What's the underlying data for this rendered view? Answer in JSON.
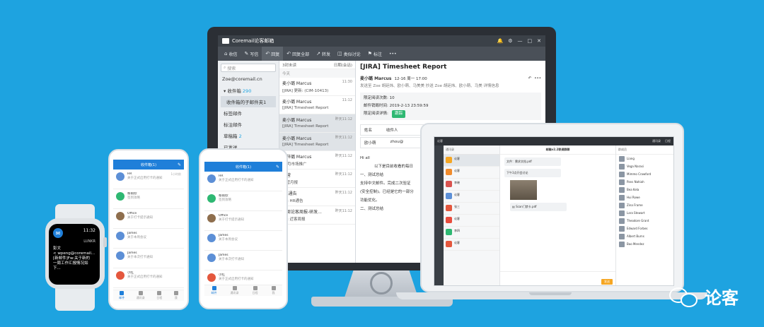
{
  "desktop": {
    "app_title": "Coremail论客邮箱",
    "toolbar": [
      {
        "icon": "inbox-icon",
        "label": "收信"
      },
      {
        "icon": "compose-icon",
        "label": "写信"
      },
      {
        "icon": "reply-icon",
        "label": "回复"
      },
      {
        "icon": "reply-all-icon",
        "label": "回复全部"
      },
      {
        "icon": "forward-icon",
        "label": "转发"
      },
      {
        "icon": "discuss-icon",
        "label": "类似讨论"
      },
      {
        "icon": "tag-icon",
        "label": "标注"
      },
      {
        "icon": "more-icon",
        "label": "•••"
      }
    ],
    "search_placeholder": "搜索",
    "account": "Zoe@coremail.cn",
    "folders": [
      {
        "label": "收件箱",
        "count": "290"
      },
      {
        "label": "收件箱的子邮件夹1",
        "count": ""
      },
      {
        "label": "标签邮件",
        "count": ""
      },
      {
        "label": "标注邮件",
        "count": ""
      },
      {
        "label": "草稿箱",
        "count": "2"
      },
      {
        "label": "已发送",
        "count": ""
      }
    ],
    "list_head_left": "3封未读",
    "list_head_right": "日期(会话)",
    "list_section": "今天",
    "mails": [
      {
        "from": "麦小璐 Marcus",
        "time": "11:30",
        "subject": "[JIRA] 更新: (CIM-10413)"
      },
      {
        "from": "麦小璐 Marcus",
        "time": "11:12",
        "subject": "[JIRA] Timesheet Report"
      },
      {
        "from": "麦小璐 Marcus",
        "time": "昨天11:12",
        "subject": "[JIRA] Timesheet Report"
      },
      {
        "from": "麦小璐 Marcus",
        "time": "昨天11:12",
        "subject": "[JIRA] Timesheet Report"
      },
      {
        "from": "麦梓璐 Marcus",
        "time": "昨天11:12",
        "subject": "10月市场推广"
      },
      {
        "from": "运营",
        "time": "昨天11:12",
        "subject": "运营月报"
      },
      {
        "from": "HR通告",
        "time": "昨天11:12",
        "subject": "Re: HR通告"
      },
      {
        "from": "本周论客周报-研发...",
        "time": "昨天11:12",
        "subject": "Re: 近客周报"
      }
    ],
    "reader": {
      "title": "[JIRA] Timesheet Report",
      "from": "麦小璐 Marcus",
      "date": "12-16 周一 17:00",
      "detail_link": "详情信息",
      "meta": "发送至  Zoe 胡廷炜、欧小萌、马美美     抄送  Zoe 胡廷炜、欧小萌、马美",
      "row1": "限定阅读次数:   10",
      "row2": "邮件销毁时间:   2019-2-13 23:59:59",
      "row3_label": "限定阅读详情:",
      "row3_tag": "跟踪",
      "table_h1": "姓名",
      "table_h2": "收件人",
      "table_c1": "欧小萌",
      "table_c2": "zhou@",
      "greeting": "Hi all",
      "body1": "以下是目前收看的每日",
      "body2": "一、测试总结",
      "body3": "支持中文邮件。完成二次验证",
      "body4": "(安全控制)。已经是它的一部分",
      "body5": "功能优化。",
      "body6": "二、测试总结"
    }
  },
  "laptop": {
    "top_items": [
      "论客",
      "通讯录",
      "日程"
    ],
    "list_head": "通讯录",
    "chat_title": "邮箱v2.2联调群聊",
    "list": [
      {
        "name": "论客",
        "color": "#f5a623"
      },
      {
        "name": "论客",
        "color": "#f08b2c"
      },
      {
        "name": "李晓",
        "color": "#d9534f"
      },
      {
        "name": "论客",
        "color": "#5c8fd6"
      },
      {
        "name": "张三",
        "color": "#e4573d"
      },
      {
        "name": "论客",
        "color": "#e84c3d"
      },
      {
        "name": "李四",
        "color": "#2eb872"
      },
      {
        "name": "论客",
        "color": "#e4573d"
      }
    ],
    "bubble1": "文件：需求文档.pdf",
    "bubble2": "下午3点开会讨论",
    "file": "Scan门禁卡.pdf",
    "send_label": "发送",
    "members_head": "群成员",
    "members": [
      "Liang",
      "Vega Narasi",
      "Mimmo Crawford",
      "Pans Nahiah",
      "Bea Kela",
      "Hui Rowe",
      "Zina Frame",
      "Lara Stewart",
      "Theodore Grant",
      "Edward Forbes",
      "Albert Burns",
      "Bao Mendez"
    ]
  },
  "phone1": {
    "title": "收件箱(1)",
    "items": [
      {
        "name": "HR",
        "text": "关于正式启用打卡的通知",
        "time": "1小时前",
        "color": "#5c8fd6"
      },
      {
        "name": "蔡雨欣",
        "text": "签到攻略",
        "time": "",
        "color": "#2eb872"
      },
      {
        "name": "Office",
        "text": "关于打卡提示通知",
        "time": "",
        "color": "#8e6e4d"
      },
      {
        "name": "James",
        "text": "关于本周会议",
        "time": "",
        "color": "#5c8fd6"
      },
      {
        "name": "James",
        "text": "关于本次打卡通知",
        "time": "",
        "color": "#5c8fd6"
      },
      {
        "name": "小红",
        "text": "关于正式启用打卡的通知",
        "time": "",
        "color": "#e4573d"
      },
      {
        "name": "小红",
        "text": "关于正式启用打卡",
        "time": "",
        "color": "#e4573d"
      }
    ],
    "tabs": [
      "邮件",
      "通讯录",
      "日程",
      "我"
    ]
  },
  "phone2": {
    "title": "收件箱(1)",
    "items": [
      {
        "name": "HR",
        "text": "关于正式启用打卡的通知",
        "color": "#5c8fd6"
      },
      {
        "name": "蔡雨欣",
        "text": "签到攻略",
        "color": "#2eb872"
      },
      {
        "name": "Office",
        "text": "关于打卡提示通知",
        "color": "#8e6e4d"
      },
      {
        "name": "James",
        "text": "关于本周会议",
        "color": "#5c8fd6"
      },
      {
        "name": "James",
        "text": "关于本次打卡通知",
        "color": "#5c8fd6"
      },
      {
        "name": "小红",
        "text": "关于正式启用打卡的通知",
        "color": "#e4573d"
      }
    ],
    "tabs": [
      "邮件",
      "通讯录",
      "日程",
      "我"
    ]
  },
  "watch": {
    "time": "11:32",
    "app_name": "LUNKR",
    "sender": "彭文",
    "line1": "< wpeng@coremail...",
    "line2": "[新邮件]Fw:关于新的",
    "line3": "一周工作汇报情况如",
    "line4": "下..."
  },
  "brand": {
    "name": "论客"
  }
}
